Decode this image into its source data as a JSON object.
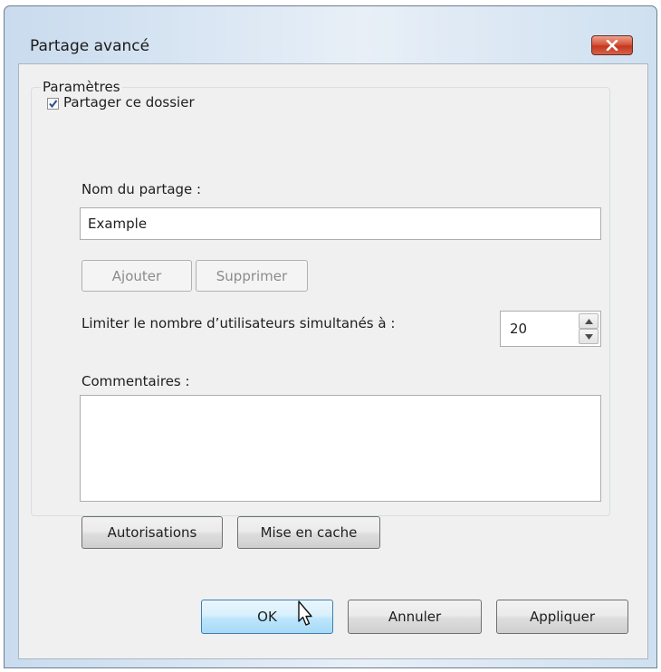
{
  "window": {
    "title": "Partage avancé",
    "close_icon": "close-icon"
  },
  "share": {
    "checkbox_label": "Partager ce dossier",
    "checked": true
  },
  "settings": {
    "group_label": "Paramètres",
    "share_name_label": "Nom du partage :",
    "share_name_value": "Example",
    "add_label": "Ajouter",
    "remove_label": "Supprimer",
    "limit_label": "Limiter le nombre d’utilisateurs simultanés à :",
    "limit_value": "20",
    "comments_label": "Commentaires :",
    "comments_value": "",
    "permissions_label": "Autorisations",
    "caching_label": "Mise en cache"
  },
  "footer": {
    "ok_label": "OK",
    "cancel_label": "Annuler",
    "apply_label": "Appliquer"
  },
  "colors": {
    "close_button": "#c2381d",
    "default_button": "#bee6fd"
  }
}
